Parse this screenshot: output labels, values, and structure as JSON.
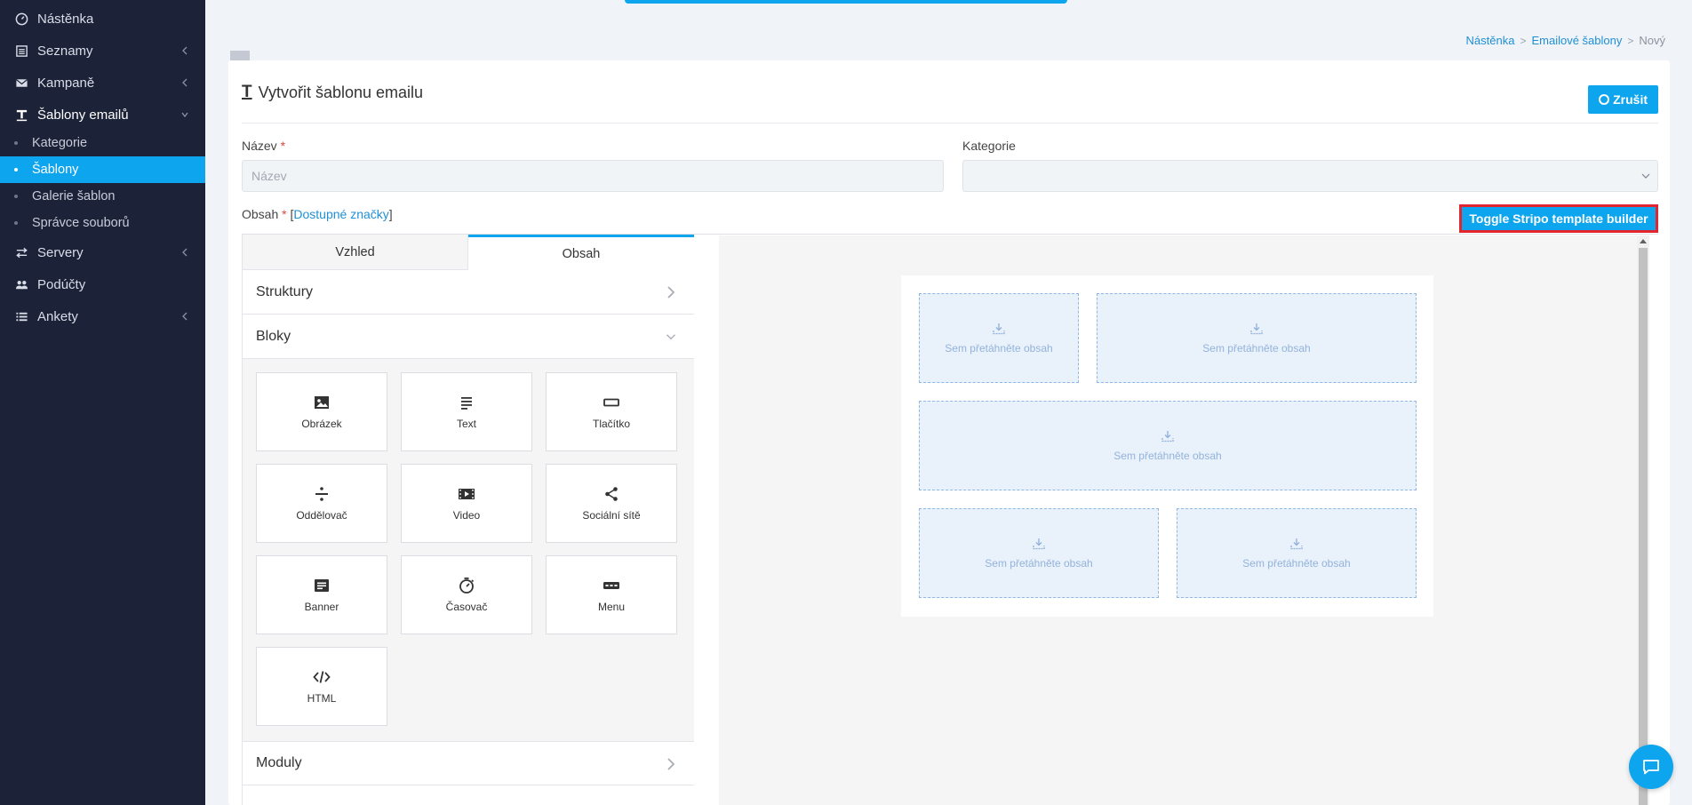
{
  "sidebar": {
    "items": [
      {
        "label": "Nástěnka",
        "icon": "dashboard-icon"
      },
      {
        "label": "Seznamy",
        "icon": "list-icon"
      },
      {
        "label": "Kampaně",
        "icon": "envelope-icon"
      },
      {
        "label": "Šablony emailů",
        "icon": "text-format-icon"
      },
      {
        "label": "Servery",
        "icon": "exchange-icon"
      },
      {
        "label": "Podúčty",
        "icon": "users-icon"
      },
      {
        "label": "Ankety",
        "icon": "poll-list-icon"
      }
    ],
    "sub_items": [
      {
        "label": "Kategorie"
      },
      {
        "label": "Šablony"
      },
      {
        "label": "Galerie šablon"
      },
      {
        "label": "Správce souborů"
      }
    ]
  },
  "breadcrumb": {
    "items": [
      "Nástěnka",
      "Emailové šablony",
      "Nový"
    ],
    "separator": ">"
  },
  "card": {
    "title": "Vytvořit šablonu emailu",
    "title_icon": "T",
    "cancel_label": "Zrušit"
  },
  "form": {
    "name_label": "Název",
    "required_mark": "*",
    "name_placeholder": "Název",
    "category_label": "Kategorie",
    "content_label": "Obsah",
    "bracket_open": "[",
    "available_tags_link": "Dostupné značky",
    "bracket_close": "]",
    "toggle_label": "Toggle Stripo template builder"
  },
  "editor": {
    "tabs": [
      {
        "label": "Vzhled"
      },
      {
        "label": "Obsah"
      }
    ],
    "sections": [
      {
        "label": "Struktury"
      },
      {
        "label": "Bloky"
      },
      {
        "label": "Moduly"
      }
    ],
    "blocks": [
      {
        "label": "Obrázek",
        "icon": "image-icon"
      },
      {
        "label": "Text",
        "icon": "text-icon"
      },
      {
        "label": "Tlačítko",
        "icon": "button-icon"
      },
      {
        "label": "Oddělovač",
        "icon": "divider-icon"
      },
      {
        "label": "Video",
        "icon": "video-icon"
      },
      {
        "label": "Sociální sítě",
        "icon": "share-icon"
      },
      {
        "label": "Banner",
        "icon": "banner-icon"
      },
      {
        "label": "Časovač",
        "icon": "timer-icon"
      },
      {
        "label": "Menu",
        "icon": "menu-icon"
      },
      {
        "label": "HTML",
        "icon": "code-icon"
      }
    ]
  },
  "canvas": {
    "drop_label": "Sem přetáhněte obsah"
  },
  "colors": {
    "accent": "#0ea5ef",
    "sidebar_bg": "#1c2237",
    "highlight_border": "#e3262d"
  }
}
